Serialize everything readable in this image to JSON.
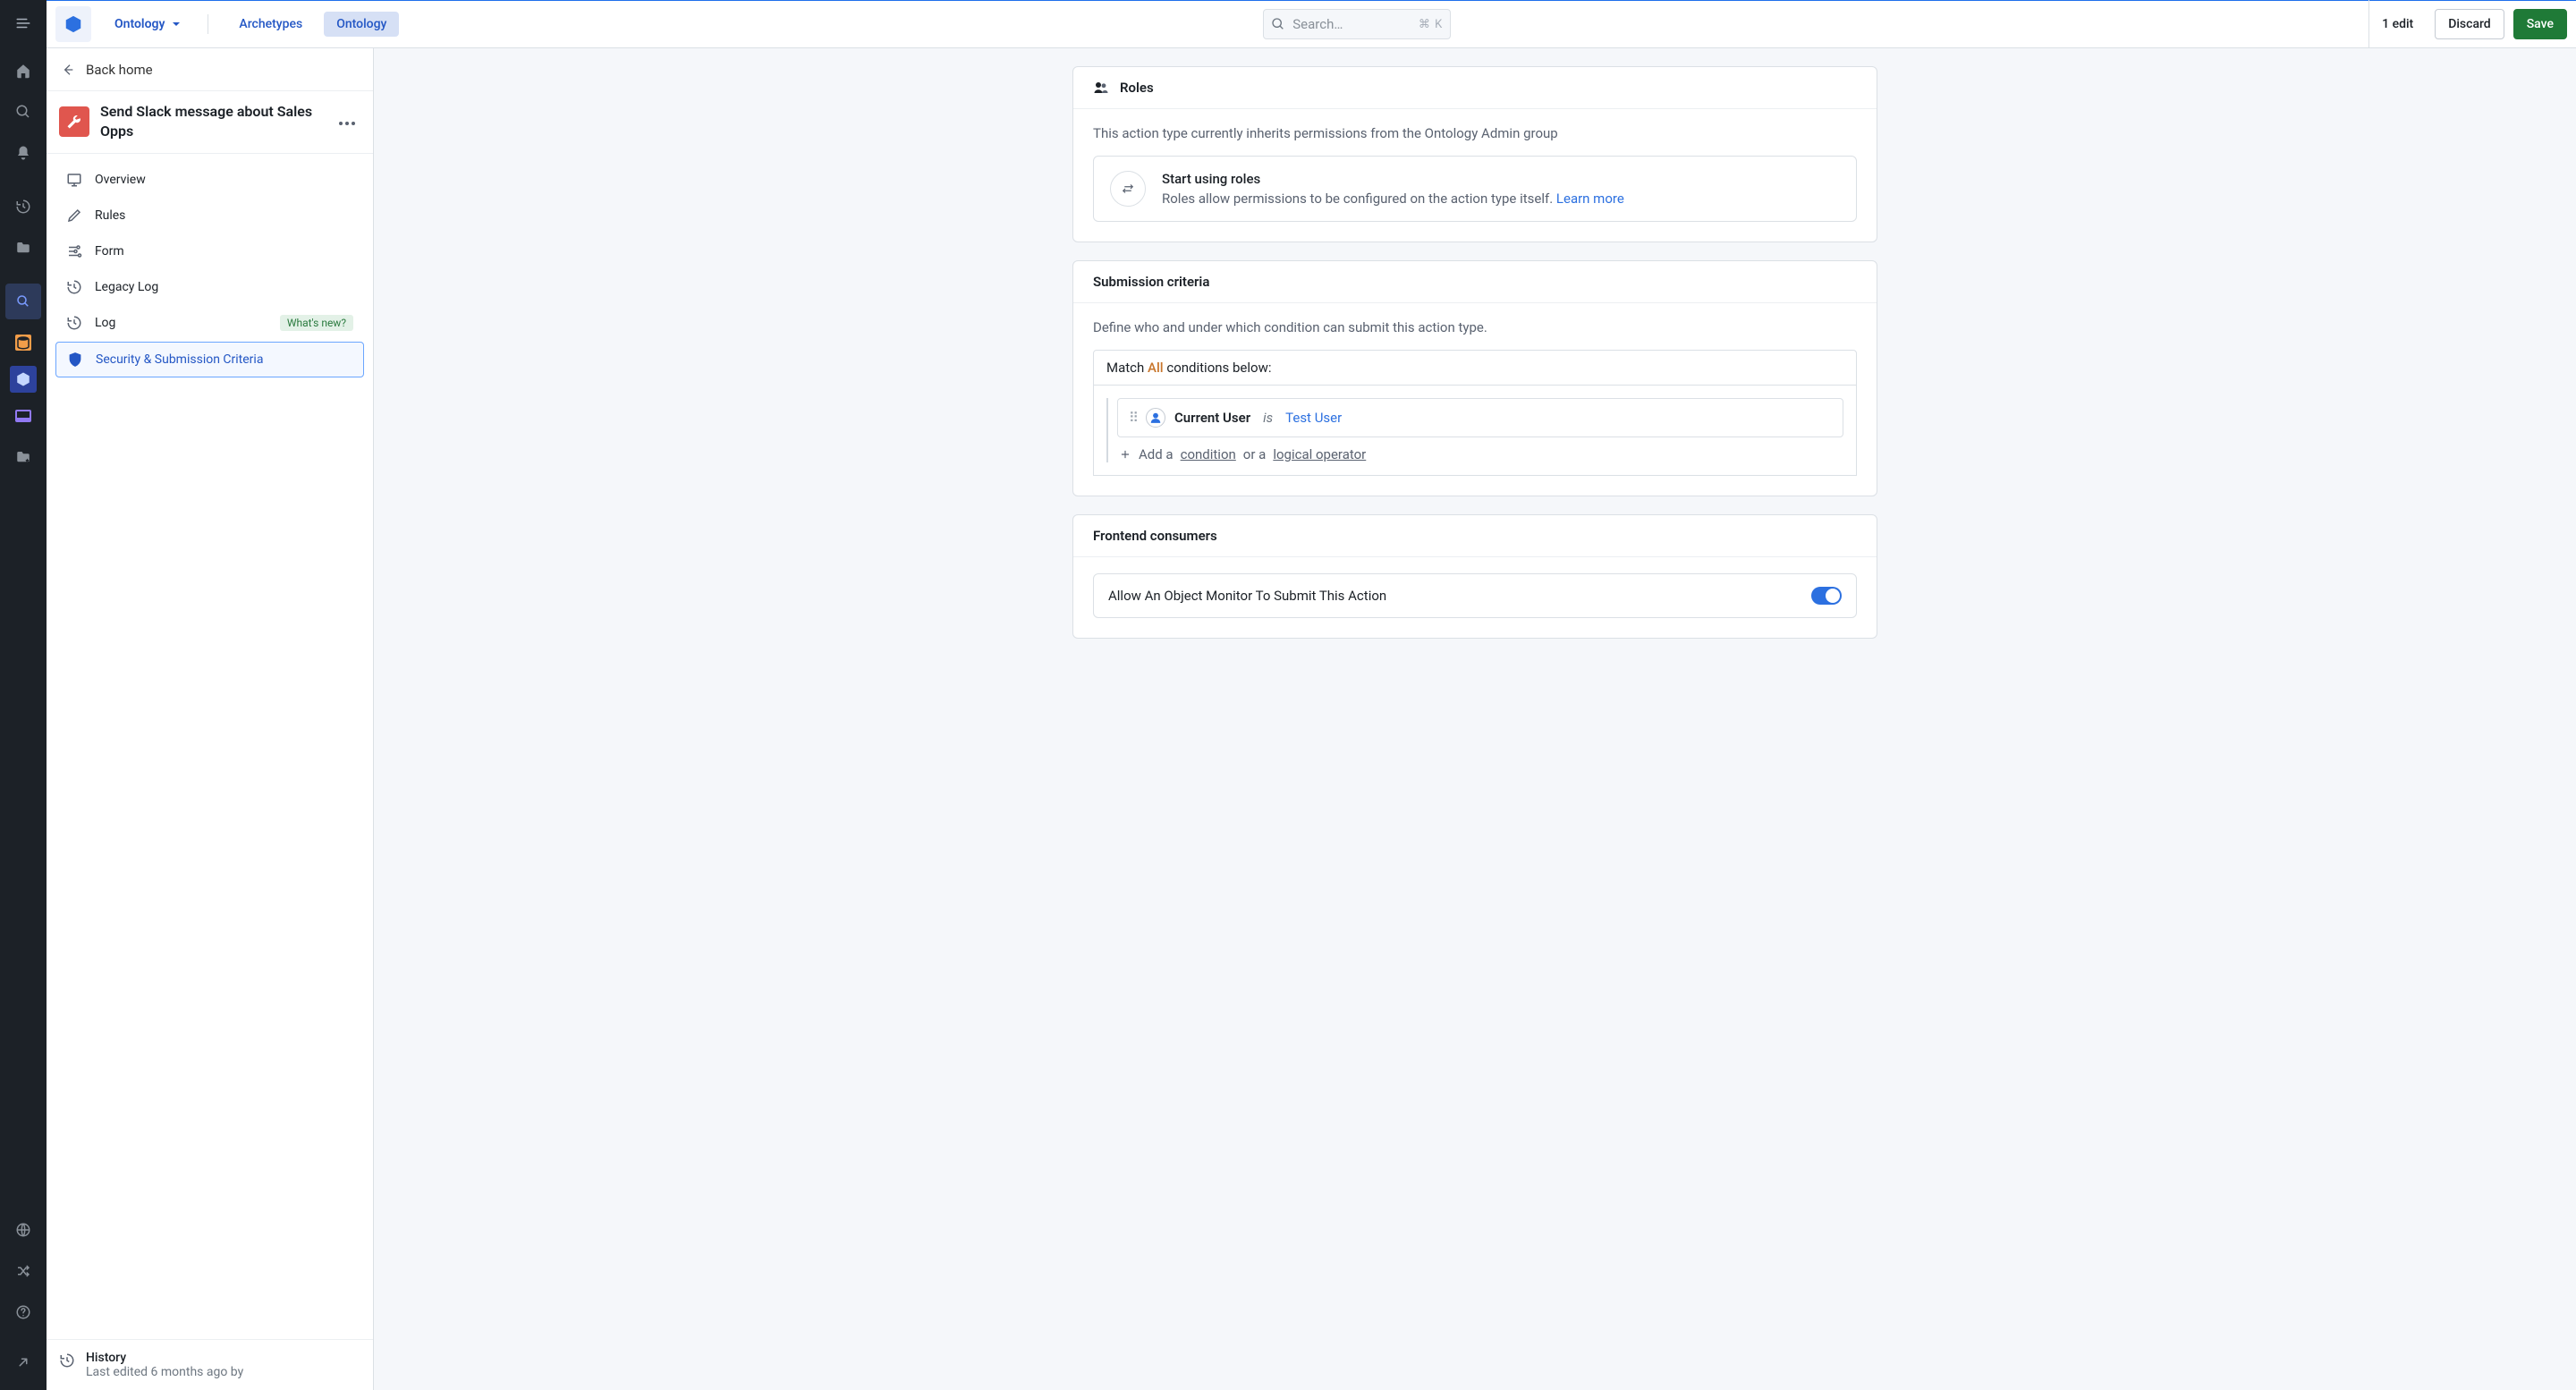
{
  "topbar": {
    "app_label": "Ontology",
    "tabs": {
      "archetypes": "Archetypes",
      "ontology": "Ontology"
    },
    "search_placeholder": "Search…",
    "search_shortcut": "⌘ K",
    "edits_count": "1 edit",
    "discard": "Discard",
    "save": "Save"
  },
  "sidepanel": {
    "back_label": "Back home",
    "action_title": "Send Slack message about Sales Opps",
    "nav": {
      "overview": "Overview",
      "rules": "Rules",
      "form": "Form",
      "legacy_log": "Legacy Log",
      "log": "Log",
      "log_badge": "What's new?",
      "security": "Security & Submission Criteria"
    },
    "history": {
      "title": "History",
      "subtitle": "Last edited 6 months ago by"
    }
  },
  "roles": {
    "title": "Roles",
    "inherit_text": "This action type currently inherits permissions from the Ontology Admin group",
    "start_title": "Start using roles",
    "start_sub": "Roles allow permissions to be configured on the action type itself.",
    "learn_more": "Learn more"
  },
  "submission": {
    "title": "Submission criteria",
    "subtext": "Define who and under which condition can submit this action type.",
    "match_prefix": "Match",
    "match_mode": "All",
    "match_suffix": "conditions below:",
    "cond_label": "Current User",
    "cond_op": "is",
    "cond_value": "Test User",
    "add_prefix": "Add a",
    "add_condition": "condition",
    "add_or": "or a",
    "add_operator": "logical operator"
  },
  "frontend": {
    "title": "Frontend consumers",
    "toggle_label": "Allow An Object Monitor To Submit This Action"
  }
}
